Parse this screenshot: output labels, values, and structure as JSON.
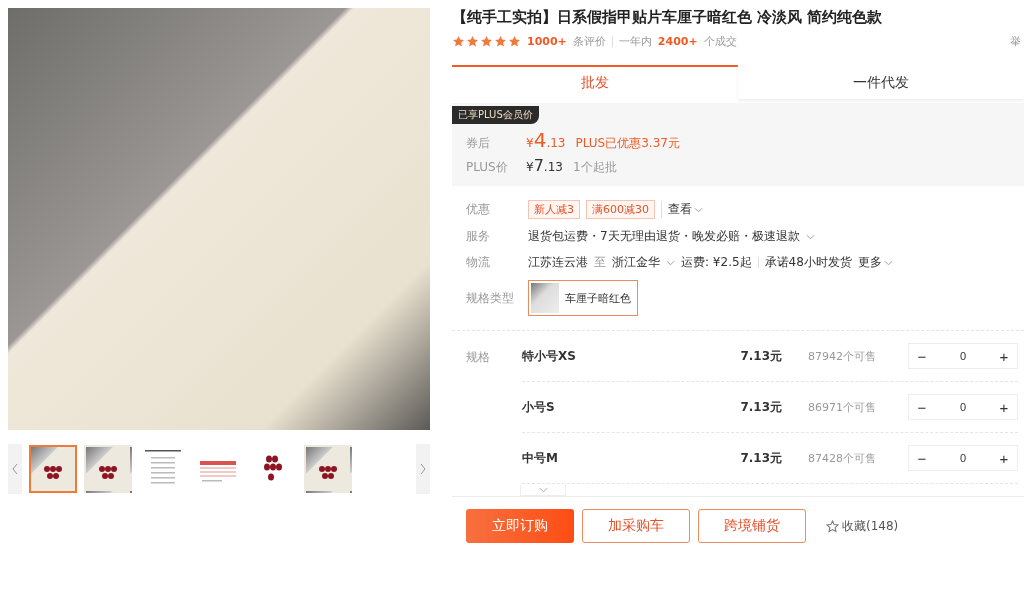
{
  "gallery": {
    "thumbnails": [
      {
        "kind": "photo",
        "selected": true
      },
      {
        "kind": "photo",
        "selected": false
      },
      {
        "kind": "document",
        "selected": false
      },
      {
        "kind": "table",
        "selected": false
      },
      {
        "kind": "nails",
        "selected": false
      },
      {
        "kind": "photo",
        "selected": false
      }
    ]
  },
  "product": {
    "title": "【纯手工实拍】日系假指甲贴片车厘子暗红色 冷淡风 简约纯色款",
    "stars": 5,
    "reviews_count": "1000+",
    "reviews_label": "条评价",
    "year_label": "一年内",
    "deals_count": "2400+",
    "deals_label": "个成交",
    "report": "举"
  },
  "tabs": [
    {
      "label": "批发",
      "selected": true
    },
    {
      "label": "一件代发",
      "selected": false
    }
  ],
  "price_box": {
    "badge": "已享PLUS会员价",
    "after_coupon_label": "券后",
    "after_coupon_currency": "¥",
    "after_coupon_int": "4",
    "after_coupon_dec": ".13",
    "plus_saving": "PLUS已优惠3.37元",
    "plus_label": "PLUS价",
    "plus_currency": "¥",
    "plus_int": "7",
    "plus_dec": ".13",
    "min_order": "1个起批"
  },
  "info": {
    "discount_label": "优惠",
    "discount_tags": [
      "新人减3",
      "满600减30"
    ],
    "discount_more": "查看",
    "service_label": "服务",
    "service_text": "退货包运费・7天无理由退货・晚发必赔・极速退款",
    "logistics_label": "物流",
    "origin": "江苏连云港",
    "to": "至",
    "destination": "浙江金华",
    "shipping": "运费: ¥2.5起",
    "promise": "承诺48小时发货",
    "more": "更多",
    "variant_label": "规格类型",
    "variant": {
      "name": "车厘子暗红色",
      "selected": true
    }
  },
  "specs": {
    "label": "规格",
    "rows": [
      {
        "name": "特小号XS",
        "price": "7.13元",
        "stock": "87942个可售",
        "qty": "0",
        "minus": "−",
        "plus": "+"
      },
      {
        "name": "小号S",
        "price": "7.13元",
        "stock": "86971个可售",
        "qty": "0",
        "minus": "−",
        "plus": "+"
      },
      {
        "name": "中号M",
        "price": "7.13元",
        "stock": "87428个可售",
        "qty": "0",
        "minus": "−",
        "plus": "+"
      }
    ]
  },
  "actions": {
    "buy": "立即订购",
    "cart": "加采购车",
    "cross_border": "跨境铺货",
    "favorite": "收藏(148)"
  }
}
